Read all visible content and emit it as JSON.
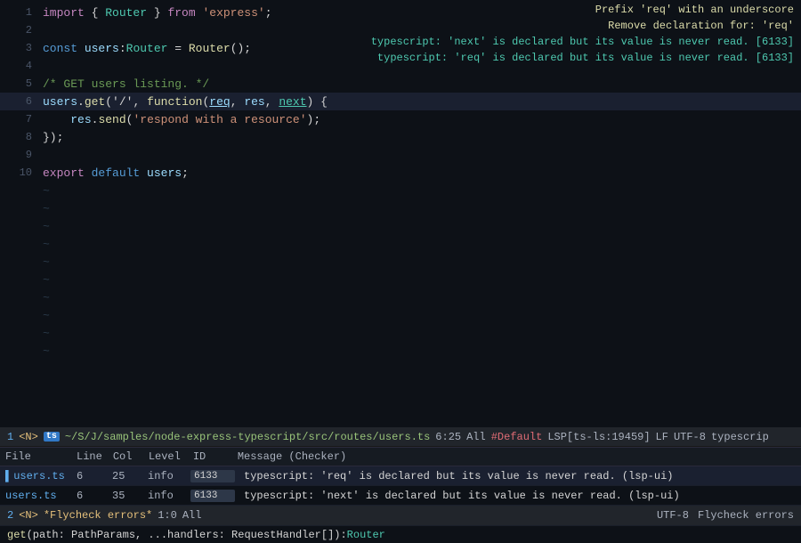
{
  "editor": {
    "lines": [
      {
        "num": 1,
        "tokens": [
          {
            "cls": "kw-import",
            "text": "import"
          },
          {
            "cls": "punct",
            "text": " { "
          },
          {
            "cls": "type-name",
            "text": "Router"
          },
          {
            "cls": "punct",
            "text": " } "
          },
          {
            "cls": "kw-from",
            "text": "from"
          },
          {
            "cls": "punct",
            "text": " "
          },
          {
            "cls": "str",
            "text": "'express'"
          },
          {
            "cls": "punct",
            "text": ";"
          }
        ]
      },
      {
        "num": 2,
        "tokens": []
      },
      {
        "num": 3,
        "tokens": [
          {
            "cls": "kw-const",
            "text": "const"
          },
          {
            "cls": "punct",
            "text": " "
          },
          {
            "cls": "var-name",
            "text": "users"
          },
          {
            "cls": "punct",
            "text": ":"
          },
          {
            "cls": "type-name",
            "text": "Router"
          },
          {
            "cls": "punct",
            "text": " = "
          },
          {
            "cls": "method",
            "text": "Router"
          },
          {
            "cls": "punct",
            "text": "();"
          }
        ]
      },
      {
        "num": 4,
        "tokens": []
      },
      {
        "num": 5,
        "tokens": [
          {
            "cls": "comment",
            "text": "/* GET users listing. */"
          }
        ]
      },
      {
        "num": 6,
        "tokens": [
          {
            "cls": "var-name",
            "text": "users"
          },
          {
            "cls": "punct",
            "text": "."
          },
          {
            "cls": "method",
            "text": "get"
          },
          {
            "cls": "punct",
            "text": "('/'"
          },
          {
            "cls": "punct",
            "text": ", "
          },
          {
            "cls": "kw-function",
            "text": "function"
          },
          {
            "cls": "punct",
            "text": "("
          },
          {
            "cls": "param-req",
            "text": "req"
          },
          {
            "cls": "punct",
            "text": ", "
          },
          {
            "cls": "param-res",
            "text": "res"
          },
          {
            "cls": "punct",
            "text": ", "
          },
          {
            "cls": "param-next",
            "text": "next"
          },
          {
            "cls": "punct",
            "text": ") {"
          }
        ],
        "highlighted": true
      },
      {
        "num": 7,
        "tokens": [
          {
            "cls": "punct",
            "text": "    "
          },
          {
            "cls": "var-name",
            "text": "res"
          },
          {
            "cls": "punct",
            "text": "."
          },
          {
            "cls": "method",
            "text": "send"
          },
          {
            "cls": "punct",
            "text": "("
          },
          {
            "cls": "str",
            "text": "'respond with a resource'"
          },
          {
            "cls": "punct",
            "text": ");"
          }
        ]
      },
      {
        "num": 8,
        "tokens": [
          {
            "cls": "punct",
            "text": "});"
          }
        ]
      },
      {
        "num": 9,
        "tokens": []
      },
      {
        "num": 10,
        "tokens": [
          {
            "cls": "kw-export",
            "text": "export"
          },
          {
            "cls": "punct",
            "text": " "
          },
          {
            "cls": "kw-default",
            "text": "default"
          },
          {
            "cls": "punct",
            "text": " "
          },
          {
            "cls": "var-name",
            "text": "users"
          },
          {
            "cls": "punct",
            "text": ";"
          }
        ]
      }
    ],
    "tildes": [
      11,
      12,
      13,
      14,
      15,
      16,
      17,
      18,
      19,
      20
    ]
  },
  "hints": {
    "line1": "Prefix 'req' with an underscore",
    "line2": "Remove declaration for: 'req'",
    "line3": "typescript: 'next' is declared but its value is never read. [6133]",
    "line4": "typescript: 'req' is declared but its value is never read. [6133]"
  },
  "status_top": {
    "num": "1",
    "bracket_open": "<N>",
    "ts_label": "ts",
    "path": "~/S/J/samples/node-express-typescript/src/routes/users.ts",
    "position": "6:25",
    "all": "All",
    "default": "#Default",
    "lsp": "LSP[ts-ls:19459]",
    "lf": "LF",
    "utf": "UTF-8",
    "typescript": "typescrip"
  },
  "diagnostics": {
    "columns": [
      "File",
      "Line",
      "Col",
      "Level",
      "ID",
      "Message (Checker)"
    ],
    "rows": [
      {
        "file": "users.ts",
        "line": "6",
        "col": "25",
        "level": "info",
        "id": "6133",
        "message": "typescript: 'req' is declared but its value is never read. (lsp-ui)"
      },
      {
        "file": "users.ts",
        "line": "6",
        "col": "35",
        "level": "info",
        "id": "6133",
        "message": "typescript: 'next' is declared but its value is never read. (lsp-ui)"
      }
    ]
  },
  "status_bottom": {
    "num": "2",
    "bracket": "<N>",
    "flycheck": "*Flycheck errors*",
    "pos": "1:0",
    "all": "All",
    "utf": "UTF-8",
    "flycheck_label": "Flycheck errors"
  },
  "minibuffer": {
    "get": "get",
    "params": "(path: PathParams, ...handlers: RequestHandler[])",
    "return_type": "Router"
  }
}
